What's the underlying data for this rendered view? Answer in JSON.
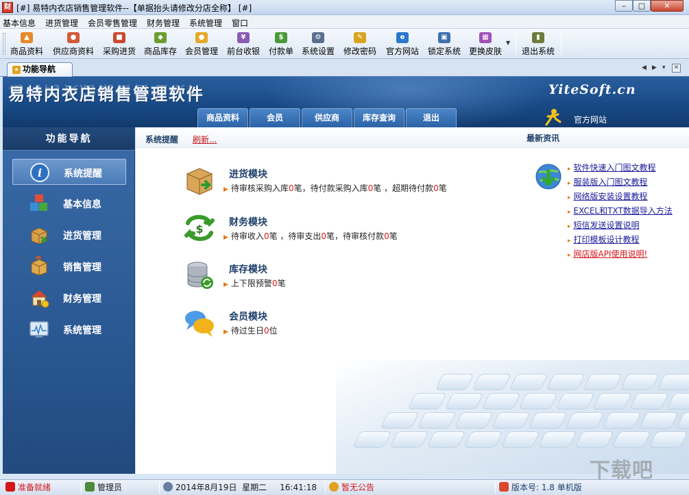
{
  "window": {
    "app_icon": "财",
    "title": "[#] 易特内衣店销售管理软件--【单据抬头请修改分店全称】 [#]",
    "min": "–",
    "max": "□",
    "close": "✕"
  },
  "menu": [
    "基本信息",
    "进货管理",
    "会员零售管理",
    "财务管理",
    "系统管理",
    "窗口"
  ],
  "toolbar": {
    "buttons": [
      {
        "label": "商品资料",
        "icon": "goods-icon",
        "color": "#e58a2a",
        "glyph": "▲"
      },
      {
        "label": "供应商资料",
        "icon": "suppliers-icon",
        "color": "#d45a3a",
        "glyph": "●"
      },
      {
        "label": "采购进货",
        "icon": "truck-icon",
        "color": "#c9482c",
        "glyph": "■"
      },
      {
        "label": "商品库存",
        "icon": "inventory-icon",
        "color": "#6a9e2e",
        "glyph": "◆"
      },
      {
        "label": "会员管理",
        "icon": "member-icon",
        "color": "#e4a92a",
        "glyph": "●"
      },
      {
        "label": "前台收银",
        "icon": "cashier-icon",
        "color": "#8a5cb4",
        "glyph": "¥"
      },
      {
        "label": "付款单",
        "icon": "payment-icon",
        "color": "#4b9a3a",
        "glyph": "$"
      },
      {
        "label": "系统设置",
        "icon": "settings-icon",
        "color": "#5a6f8e",
        "glyph": "⚙"
      },
      {
        "label": "修改密码",
        "icon": "key-icon",
        "color": "#d8a31f",
        "glyph": "✎"
      },
      {
        "label": "官方网站",
        "icon": "ie-icon",
        "color": "#2b78c9",
        "glyph": "e"
      },
      {
        "label": "锁定系统",
        "icon": "lock-icon",
        "color": "#3e6fb0",
        "glyph": "▣"
      },
      {
        "label": "更换皮肤",
        "icon": "skin-icon",
        "color": "#a14fb7",
        "glyph": "▦"
      },
      {
        "label": "退出系统",
        "icon": "exit-icon",
        "color": "#6d7a3a",
        "glyph": "▮"
      }
    ],
    "dropdown_glyph": "▼"
  },
  "tab": {
    "label": "功能导航",
    "icon_glyph": "★",
    "prev": "◀",
    "next": "▶",
    "list": "▾",
    "close": "✕"
  },
  "banner": {
    "title": "易特内衣店销售管理软件",
    "brand": "YiteSoft.cn",
    "tabs": [
      "商品资料",
      "会员",
      "供应商",
      "库存查询",
      "退出"
    ],
    "official_site": "官方网站"
  },
  "sidebar": {
    "heading": "功能导航",
    "items": [
      {
        "label": "系统提醒",
        "icon": "info-icon",
        "active": true
      },
      {
        "label": "基本信息",
        "icon": "cubes-icon",
        "active": false
      },
      {
        "label": "进货管理",
        "icon": "box-in-icon",
        "active": false
      },
      {
        "label": "销售管理",
        "icon": "box-out-icon",
        "active": false
      },
      {
        "label": "财务管理",
        "icon": "house-money-icon",
        "active": false
      },
      {
        "label": "系统管理",
        "icon": "monitor-icon",
        "active": false
      }
    ]
  },
  "main": {
    "section_title": "系统提醒",
    "refresh": "刷新...",
    "news_title": "最新资讯",
    "modules": [
      {
        "title": "进货模块",
        "parts": [
          "待审核采购入库",
          "0",
          "笔，待付款采购入库",
          "0",
          "笔 ，超期待付款",
          "0",
          "笔"
        ]
      },
      {
        "title": "财务模块",
        "parts": [
          "待审收入",
          "0",
          "笔 ，待审支出",
          "0",
          "笔，待审核付款",
          "0",
          "笔"
        ]
      },
      {
        "title": "库存模块",
        "parts": [
          "上下限预警",
          "0",
          "笔"
        ]
      },
      {
        "title": "会员模块",
        "parts": [
          "待过生日",
          "0",
          "位"
        ]
      }
    ],
    "news": [
      "软件快速入门图文教程",
      "服装版入门图文教程",
      "网络版安装设置教程",
      "EXCEL和TXT数据导入方法",
      "短信发送设置说明",
      "打印模板设计教程",
      "网店版API使用说明!"
    ]
  },
  "status": {
    "ready": "准备就绪",
    "user": "管理员",
    "datetime": "2014年8月19日  星期二     16:41:18",
    "notice": "暂无公告",
    "version": "版本号: 1.8 单机版"
  },
  "colors": {
    "accent_red": "#d6141b",
    "banner_blue": "#184a86",
    "sidebar_blue": "#2a5892"
  }
}
